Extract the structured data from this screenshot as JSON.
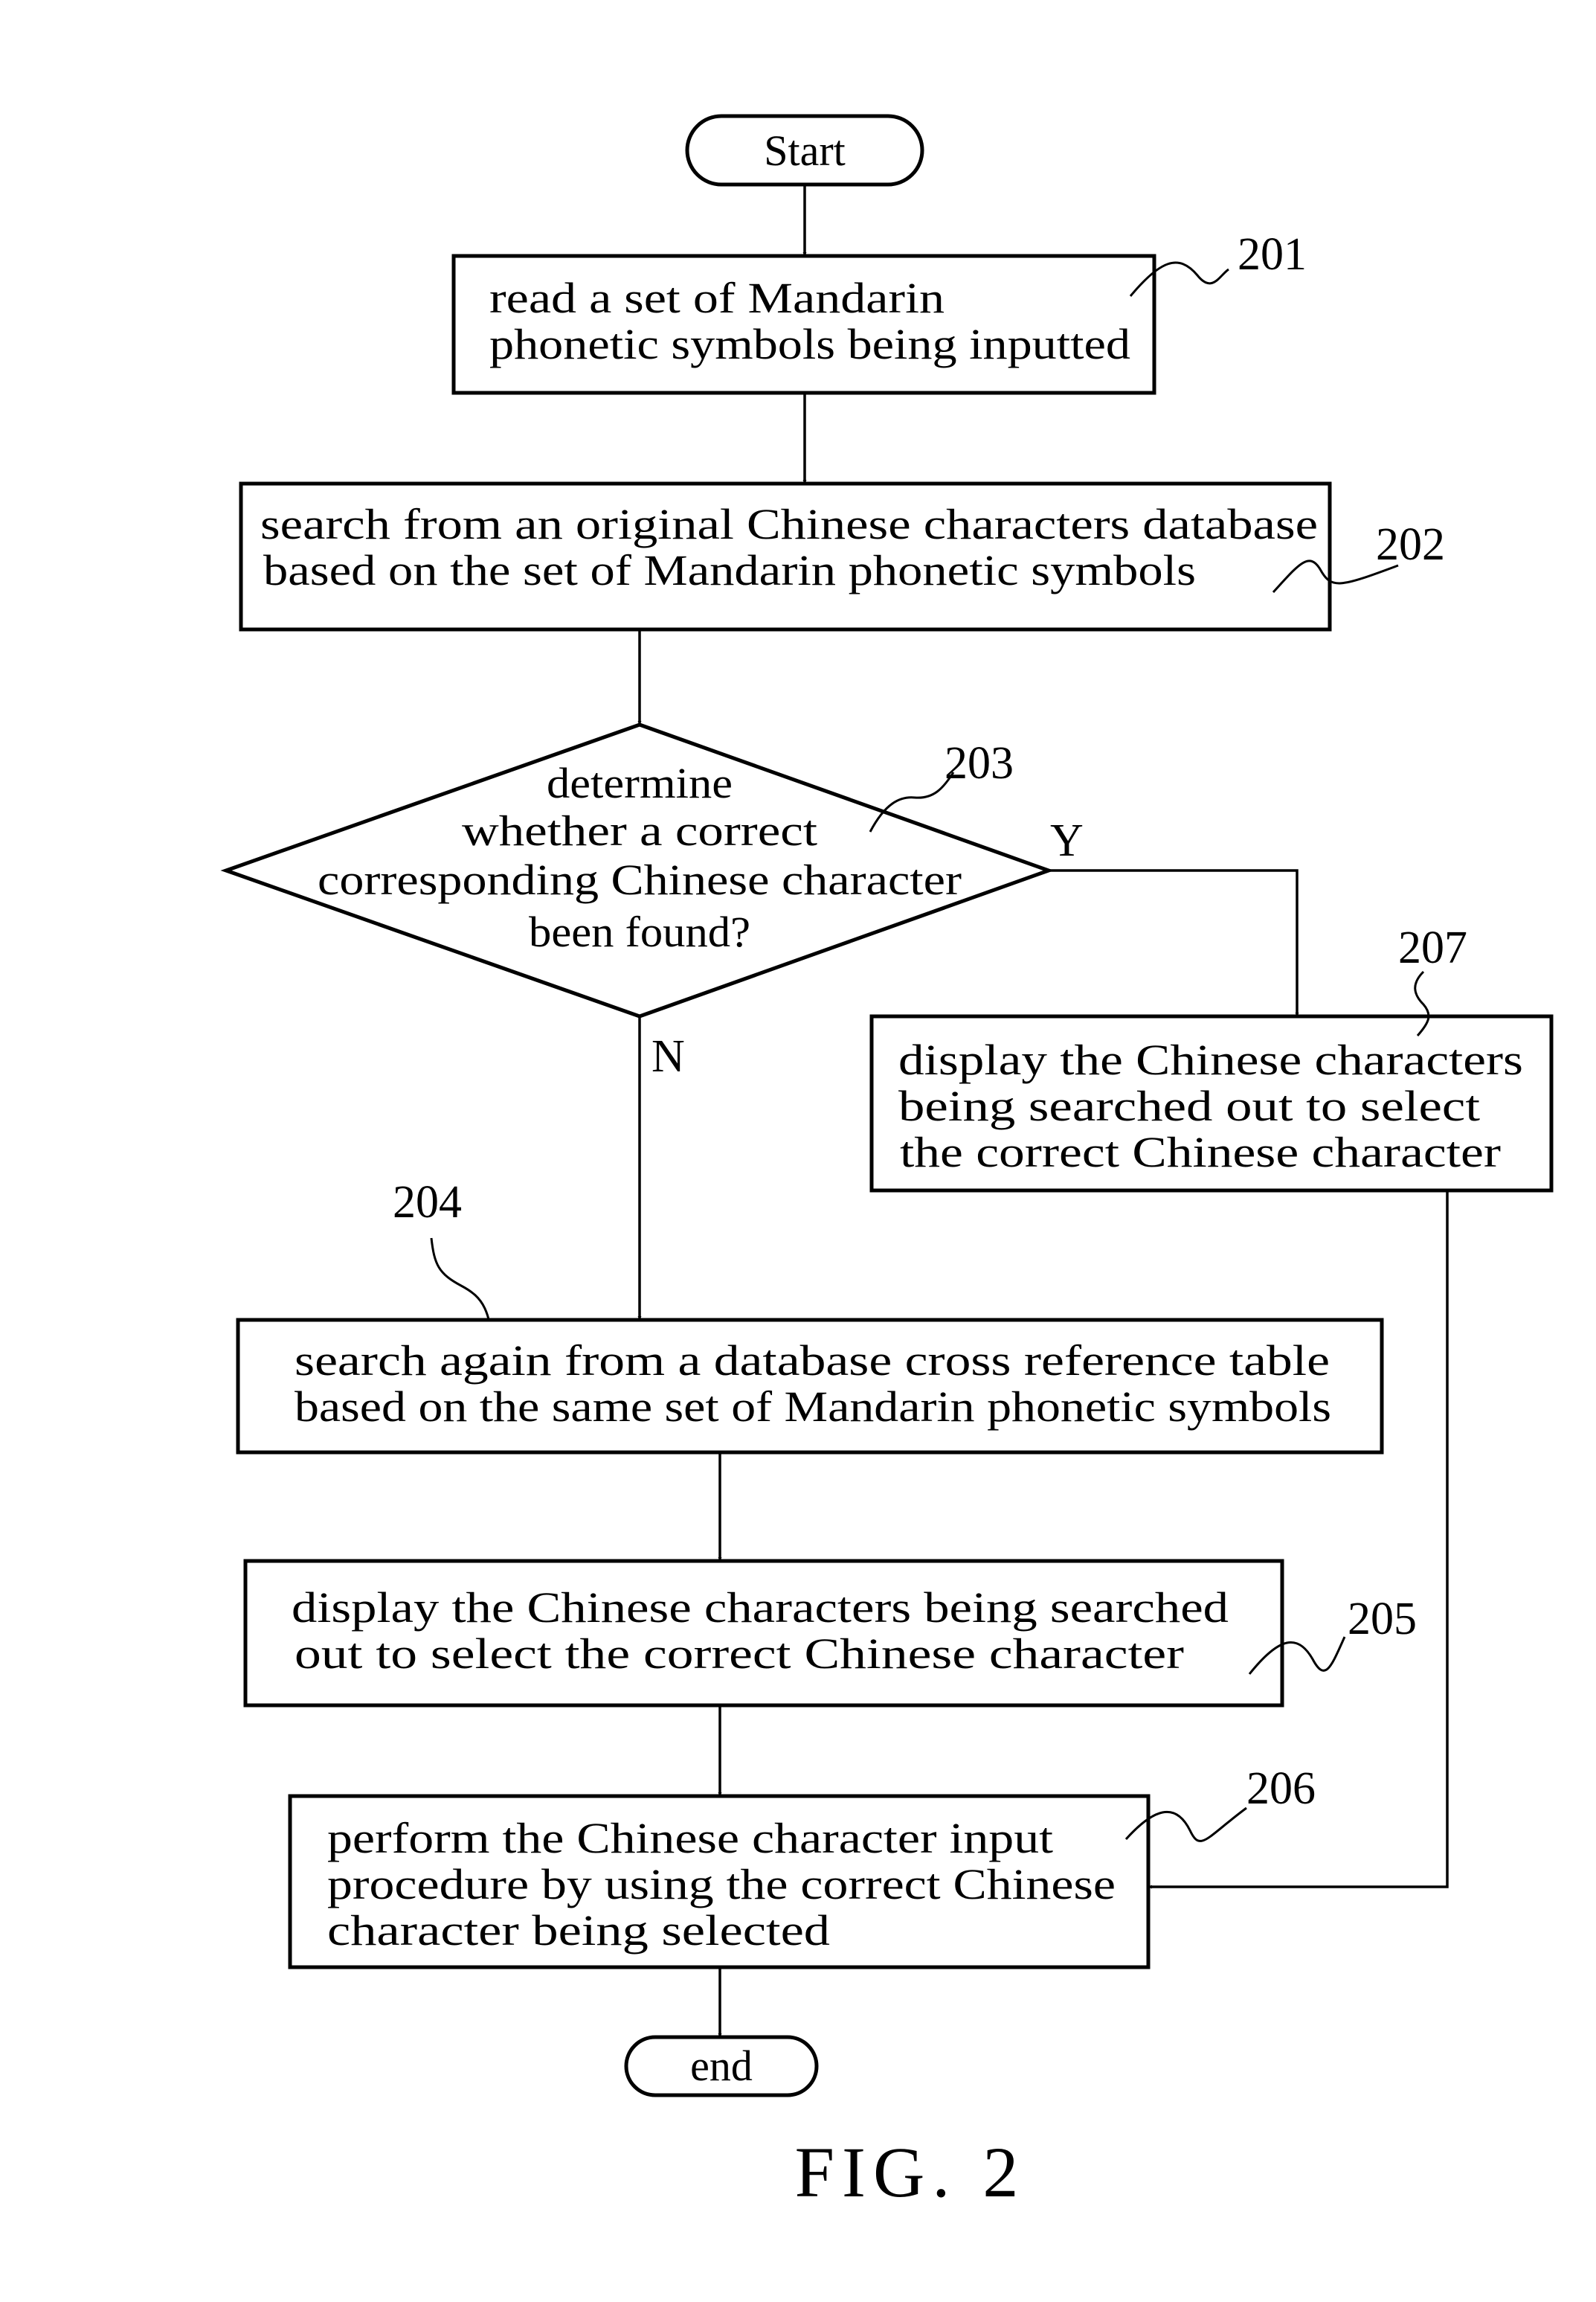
{
  "figure": {
    "caption": "FIG. 2",
    "terminals": {
      "start": "Start",
      "end": "end"
    },
    "steps": [
      {
        "ref": "201",
        "lines": [
          "read a set of Mandarin",
          "phonetic symbols being inputted"
        ]
      },
      {
        "ref": "202",
        "lines": [
          "search from an original Chinese characters database",
          "based on the set of Mandarin phonetic symbols"
        ]
      },
      {
        "ref": "203",
        "lines": [
          "determine",
          "whether a correct",
          "corresponding Chinese character",
          "been found?"
        ]
      },
      {
        "ref": "204",
        "lines": [
          "search again from a database cross reference table",
          "based on the same set of Mandarin phonetic symbols"
        ]
      },
      {
        "ref": "205",
        "lines": [
          "display the Chinese characters being searched",
          "out to select the correct Chinese character"
        ]
      },
      {
        "ref": "206",
        "lines": [
          "perform the Chinese character input",
          "procedure by using the correct Chinese",
          "character being selected"
        ]
      },
      {
        "ref": "207",
        "lines": [
          "display the Chinese characters",
          "being searched out to select",
          "the correct Chinese character"
        ]
      }
    ],
    "branches": {
      "yes": "Y",
      "no": "N"
    },
    "colors": {
      "ink": "#000000",
      "paper": "#ffffff"
    }
  }
}
